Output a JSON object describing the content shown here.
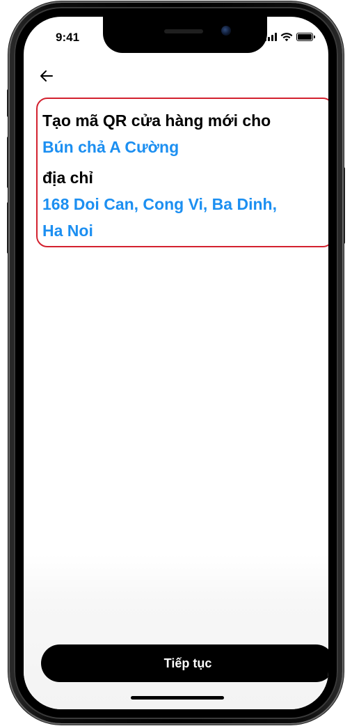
{
  "status_bar": {
    "time": "9:41",
    "icons": [
      "cellular-signal-icon",
      "wifi-icon",
      "battery-icon"
    ]
  },
  "nav": {
    "back_icon": "arrow-left-icon"
  },
  "content": {
    "title_line": "Tạo mã QR cửa hàng mới cho",
    "store_name": "Bún chả A Cường",
    "address_label": "địa chỉ",
    "address_line_1": "168 Doi Can, Cong Vi, Ba Dinh,",
    "address_line_2": "Ha Noi"
  },
  "footer": {
    "continue_label": "Tiếp tục"
  },
  "colors": {
    "accent_blue": "#1c8ff1",
    "highlight_red": "#d3212f",
    "text_black": "#000000",
    "button_black": "#000000",
    "button_text": "#ffffff"
  }
}
